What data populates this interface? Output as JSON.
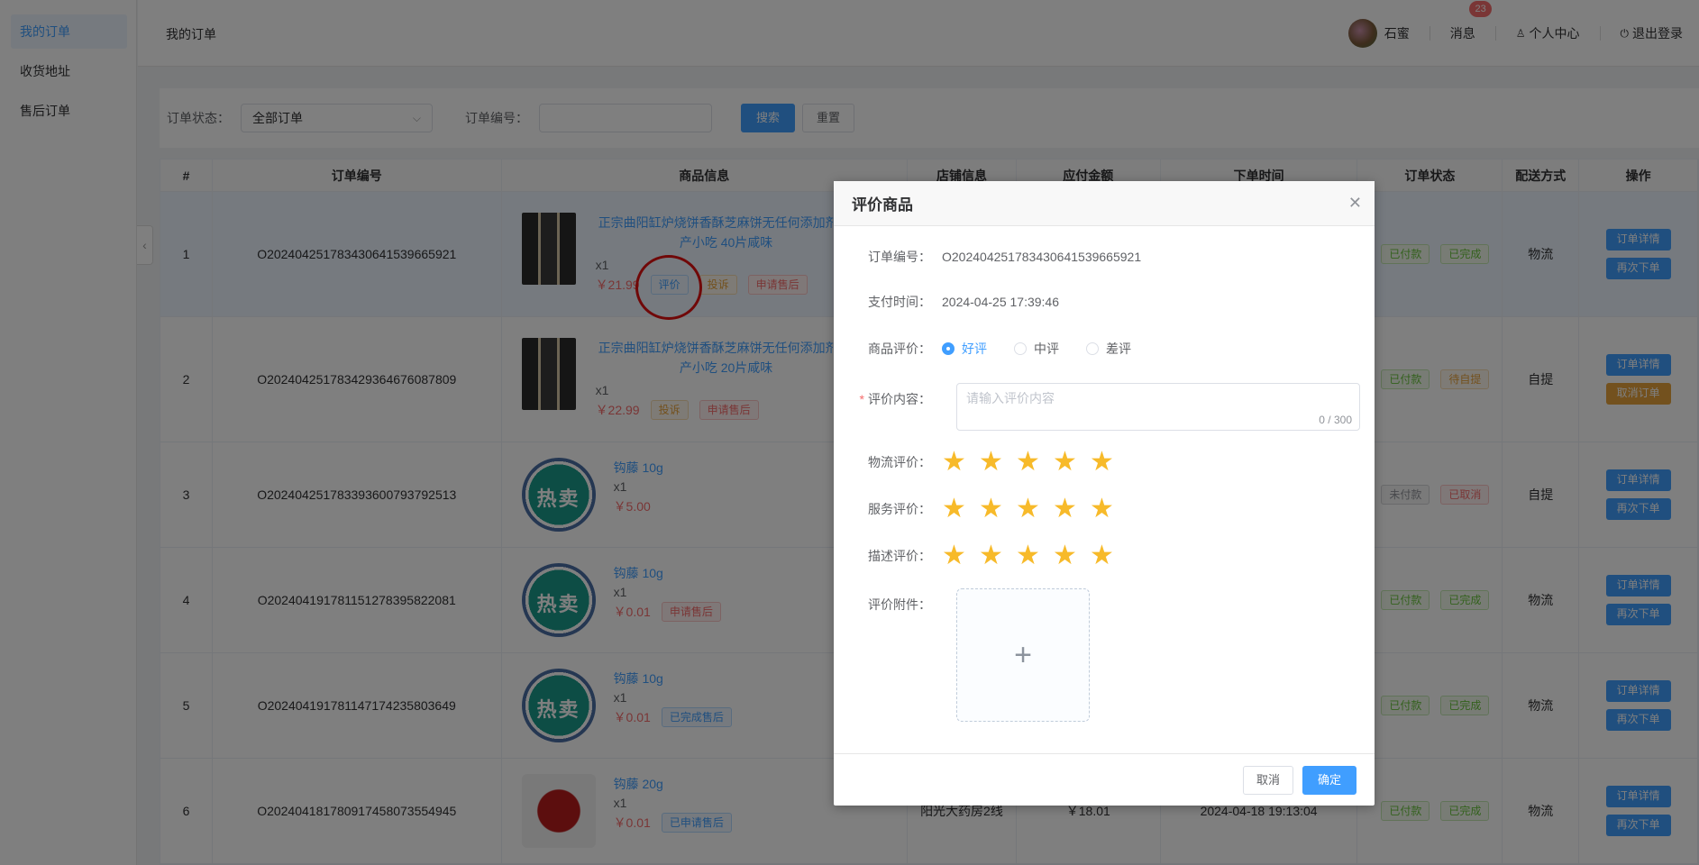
{
  "sidebar": {
    "items": [
      {
        "label": "我的订单"
      },
      {
        "label": "收货地址"
      },
      {
        "label": "售后订单"
      }
    ]
  },
  "header": {
    "page_title": "我的订单",
    "username": "石蜜",
    "messages_label": "消息",
    "messages_badge": "23",
    "profile_label": "个人中心",
    "logout_label": "退出登录"
  },
  "filter": {
    "status_label": "订单状态：",
    "status_value": "全部订单",
    "order_no_label": "订单编号：",
    "order_no_value": "",
    "search_label": "搜索",
    "reset_label": "重置"
  },
  "table": {
    "headers": [
      "#",
      "订单编号",
      "商品信息",
      "店铺信息",
      "应付金额",
      "下单时间",
      "订单状态",
      "配送方式",
      "操作"
    ],
    "rows": [
      {
        "idx": "1",
        "order_no": "O20240425178343064153966592​1",
        "goods_name": "正宗曲阳缸炉烧饼香酥芝麻饼无任何添加剂 特产小吃 40片咸味",
        "qty": "x1",
        "price": "￥21.99",
        "tags": [
          "评价",
          "投诉",
          "申请售后"
        ],
        "pay_status": "已付款",
        "order_status": "已完成",
        "ship": "物流",
        "ops": [
          "订单详情",
          "再次下单"
        ]
      },
      {
        "idx": "2",
        "order_no": "O20240425178342936467608780​9",
        "goods_name": "正宗曲阳缸炉烧饼香酥芝麻饼无任何添加剂 特产小吃 20片咸味",
        "qty": "x1",
        "price": "￥22.99",
        "tags": [
          "投诉",
          "申请售后"
        ],
        "pay_status": "已付款",
        "order_status": "待自提",
        "ship": "自提",
        "ops": [
          "订单详情",
          "取消订单"
        ]
      },
      {
        "idx": "3",
        "order_no": "O20240425178339360079379251​3",
        "goods_name": "钩藤 10g",
        "qty": "x1",
        "price": "￥5.00",
        "tags": [],
        "pay_status": "未付款",
        "order_status": "已取消",
        "ship": "自提",
        "ops": [
          "订单详情",
          "再次下单"
        ]
      },
      {
        "idx": "4",
        "order_no": "O20240419178115127839582208​1",
        "goods_name": "钩藤 10g",
        "qty": "x1",
        "price": "￥0.01",
        "tags": [
          "申请售后"
        ],
        "pay_status": "已付款",
        "order_status": "已完成",
        "ship": "物流",
        "ops": [
          "订单详情",
          "再次下单"
        ]
      },
      {
        "idx": "5",
        "order_no": "O20240419178114717423580364​9",
        "goods_name": "钩藤 10g",
        "qty": "x1",
        "price": "￥0.01",
        "tags": [
          "已完成售后"
        ],
        "pay_status": "已付款",
        "order_status": "已完成",
        "ship": "物流",
        "ops": [
          "订单详情",
          "再次下单"
        ]
      },
      {
        "idx": "6",
        "order_no": "O20240418178091745807355494​5",
        "goods_name": "钩藤 20g",
        "qty": "x1",
        "price": "￥0.01",
        "tags": [
          "已申请售后"
        ],
        "shop": "阳光大药房2线",
        "amount": "￥18.01",
        "time": "2024-04-18 19:13:04",
        "pay_status": "已付款",
        "order_status": "已完成",
        "ship": "物流",
        "ops": [
          "订单详情",
          "再次下单"
        ]
      }
    ]
  },
  "thumb_text": "热卖",
  "dialog": {
    "title": "评价商品",
    "order_no_label": "订单编号：",
    "order_no": "O202404251783430641539665921",
    "pay_time_label": "支付时间：",
    "pay_time": "2024-04-25 17:39:46",
    "rating_label": "商品评价：",
    "rating_options": [
      "好评",
      "中评",
      "差评"
    ],
    "rating_selected": "好评",
    "content_label": "评价内容：",
    "content_placeholder": "请输入评价内容",
    "content_count": "0 / 300",
    "logistics_label": "物流评价：",
    "logistics_stars": 5,
    "service_label": "服务评价：",
    "service_stars": 5,
    "desc_label": "描述评价：",
    "desc_stars": 5,
    "attach_label": "评价附件：",
    "cancel_label": "取消",
    "confirm_label": "确定"
  },
  "colors": {
    "primary": "#409eff",
    "danger": "#f56c6c",
    "warning": "#e6a23c",
    "success": "#67c23a",
    "star": "#f7ba2a"
  }
}
